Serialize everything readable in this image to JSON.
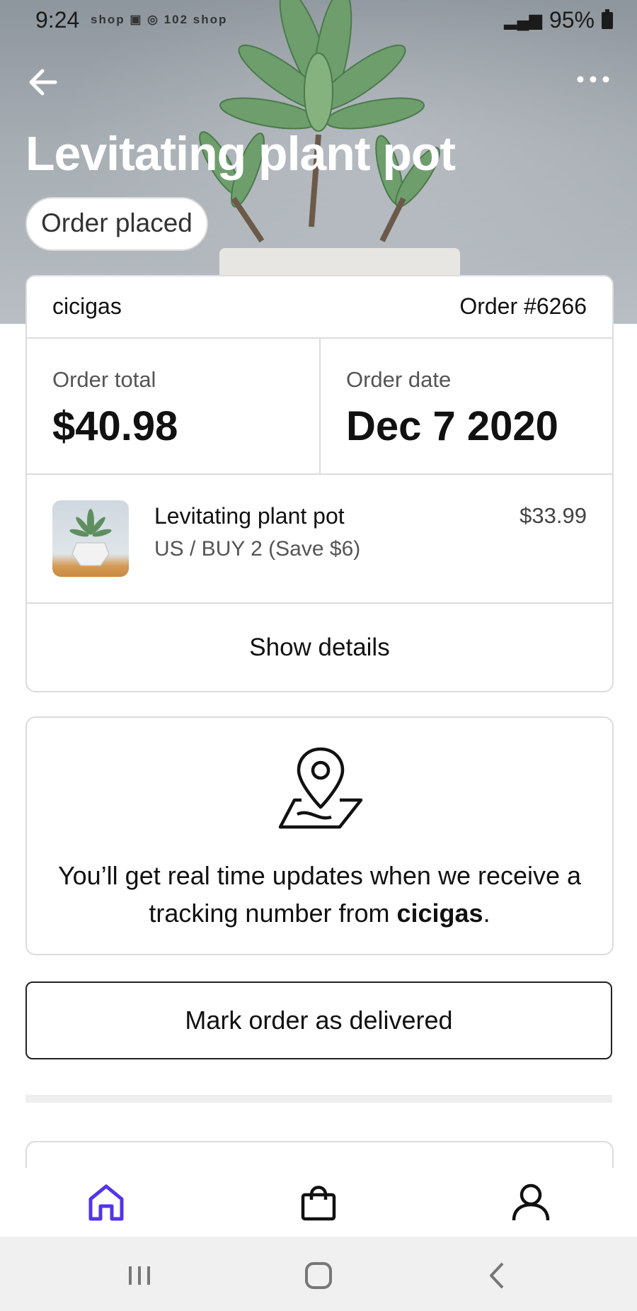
{
  "status_bar": {
    "time": "9:24",
    "notification_icons": "shop  ▣  ◎ 102 shop",
    "battery": "95%"
  },
  "header": {
    "title": "Levitating plant pot",
    "status_pill": "Order placed"
  },
  "order": {
    "store": "cicigas",
    "number": "Order #6266",
    "total_label": "Order total",
    "total_value": "$40.98",
    "date_label": "Order date",
    "date_value": "Dec 7 2020",
    "item": {
      "name": "Levitating plant pot",
      "variant": "US / BUY 2 (Save $6)",
      "price": "$33.99"
    },
    "show_details_label": "Show details"
  },
  "tracking": {
    "text_before": "You’ll get real time updates when we receive a tracking number from ",
    "store": "cicigas",
    "text_after": "."
  },
  "mark_delivered_label": "Mark order as delivered",
  "bottom_nav": {
    "items": [
      "home",
      "shop",
      "account"
    ],
    "active_color": "#5433eb"
  }
}
